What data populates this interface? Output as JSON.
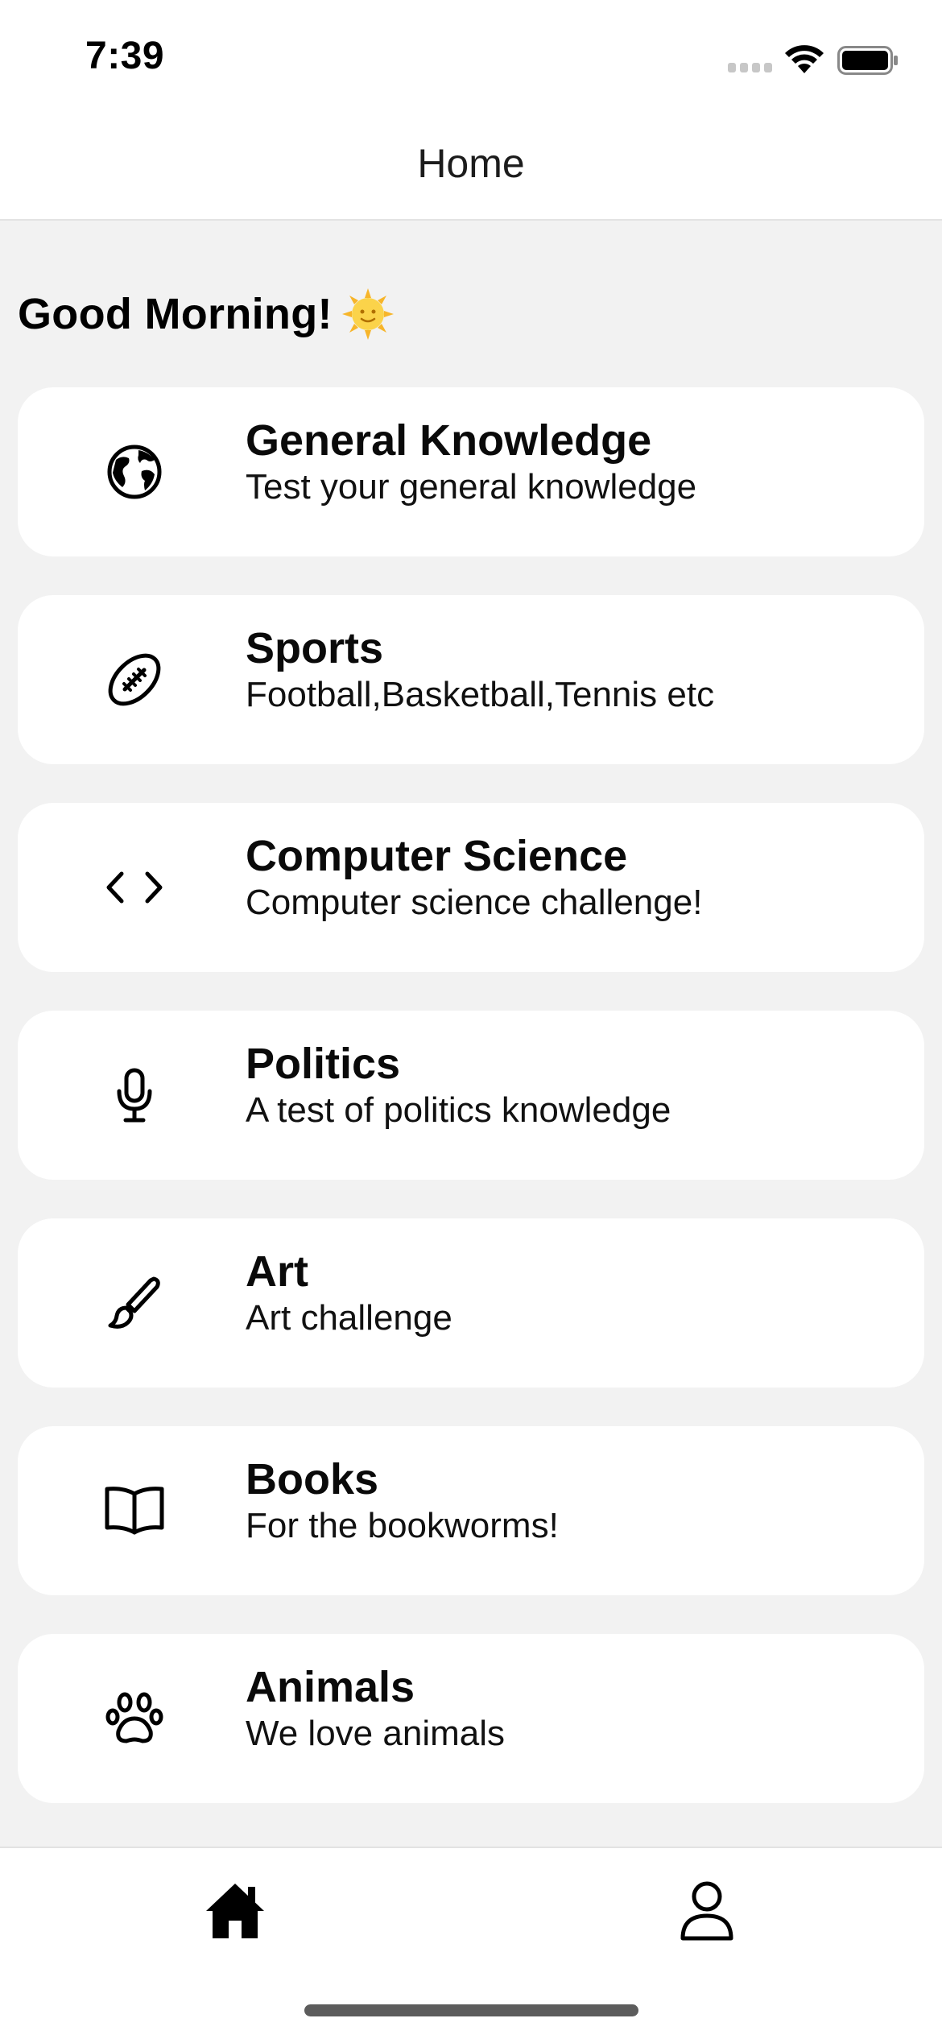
{
  "status_bar": {
    "time": "7:39"
  },
  "nav": {
    "title": "Home"
  },
  "greeting": {
    "text": "Good Morning!",
    "emoji_icon": "sun-with-face-icon"
  },
  "categories": [
    {
      "title": "General Knowledge",
      "subtitle": "Test your general knowledge",
      "icon": "globe-icon"
    },
    {
      "title": "Sports",
      "subtitle": "Football,Basketball,Tennis etc",
      "icon": "football-icon"
    },
    {
      "title": "Computer Science",
      "subtitle": "Computer science challenge!",
      "icon": "code-icon"
    },
    {
      "title": "Politics",
      "subtitle": "A test of politics knowledge",
      "icon": "microphone-icon"
    },
    {
      "title": "Art",
      "subtitle": "Art challenge",
      "icon": "paintbrush-icon"
    },
    {
      "title": "Books",
      "subtitle": "For the bookworms!",
      "icon": "book-icon"
    },
    {
      "title": "Animals",
      "subtitle": "We love animals",
      "icon": "paw-icon"
    }
  ],
  "tab_bar": {
    "home_icon": "home-icon",
    "profile_icon": "person-icon"
  }
}
